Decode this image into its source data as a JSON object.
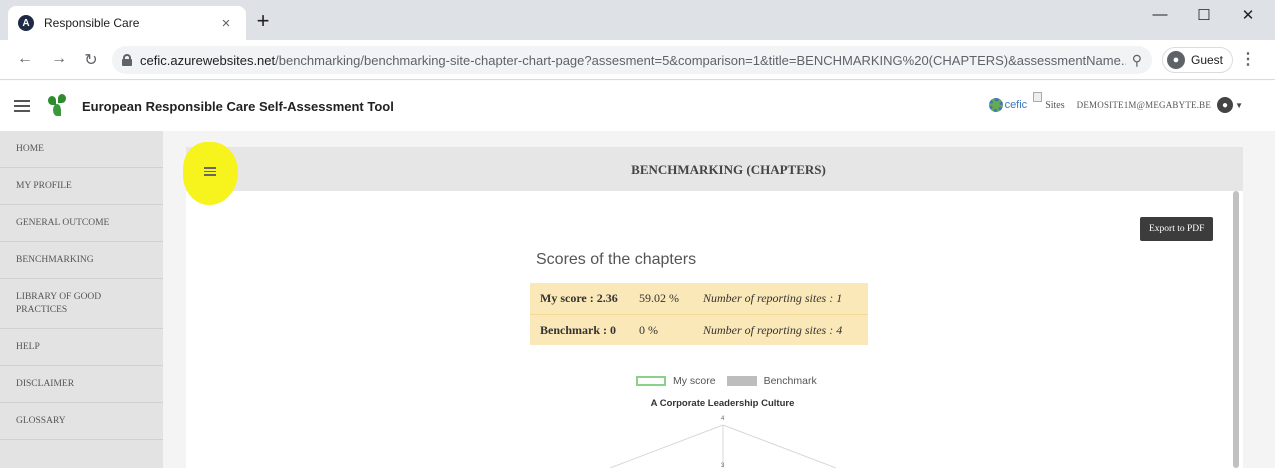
{
  "browser": {
    "tab_title": "Responsible Care",
    "tab_close": "×",
    "new_tab": "+",
    "url_host": "cefic.azurewebsites.net",
    "url_path": "/benchmarking/benchmarking-site-chapter-chart-page?assesment=5&comparison=1&title=BENCHMARKING%20(CHAPTERS)&assessmentName...",
    "profile_label": "Guest",
    "icons": [
      "back-icon",
      "forward-icon",
      "reload-icon",
      "lock-icon",
      "zoom-icon",
      "guest-avatar-icon",
      "menu-kebab-icon"
    ]
  },
  "header": {
    "app_title": "European Responsible Care Self-Assessment Tool",
    "cefic_label": "cefic",
    "sites_label": "Sites",
    "user_email": "DEMOSITE1M@MEGABYTE.BE"
  },
  "sidebar": {
    "items": [
      {
        "label": "HOME"
      },
      {
        "label": "MY PROFILE"
      },
      {
        "label": "GENERAL OUTCOME"
      },
      {
        "label": "BENCHMARKING"
      },
      {
        "label": "LIBRARY OF GOOD PRACTICES"
      },
      {
        "label": "HELP"
      },
      {
        "label": "DISCLAIMER"
      },
      {
        "label": "GLOSSARY"
      }
    ]
  },
  "main": {
    "card_title": "BENCHMARKING (CHAPTERS)",
    "export_label": "Export to PDF",
    "chart_title": "Scores of the chapters",
    "scores": [
      {
        "label": "My score : 2.36",
        "percent": "59.02 %",
        "sites": "Number of reporting sites : 1"
      },
      {
        "label": "Benchmark : 0",
        "percent": "0 %",
        "sites": "Number of reporting sites : 4"
      }
    ]
  },
  "chart_data": {
    "type": "radar",
    "axis_label": "A Corporate Leadership Culture",
    "tick_labels": [
      "4",
      "3"
    ],
    "series": [
      {
        "name": "My score"
      },
      {
        "name": "Benchmark"
      }
    ],
    "colors": {
      "my_score_border": "#8bd08b",
      "benchmark_fill": "#bdbdbd",
      "highlight": "#f6f31d"
    }
  }
}
